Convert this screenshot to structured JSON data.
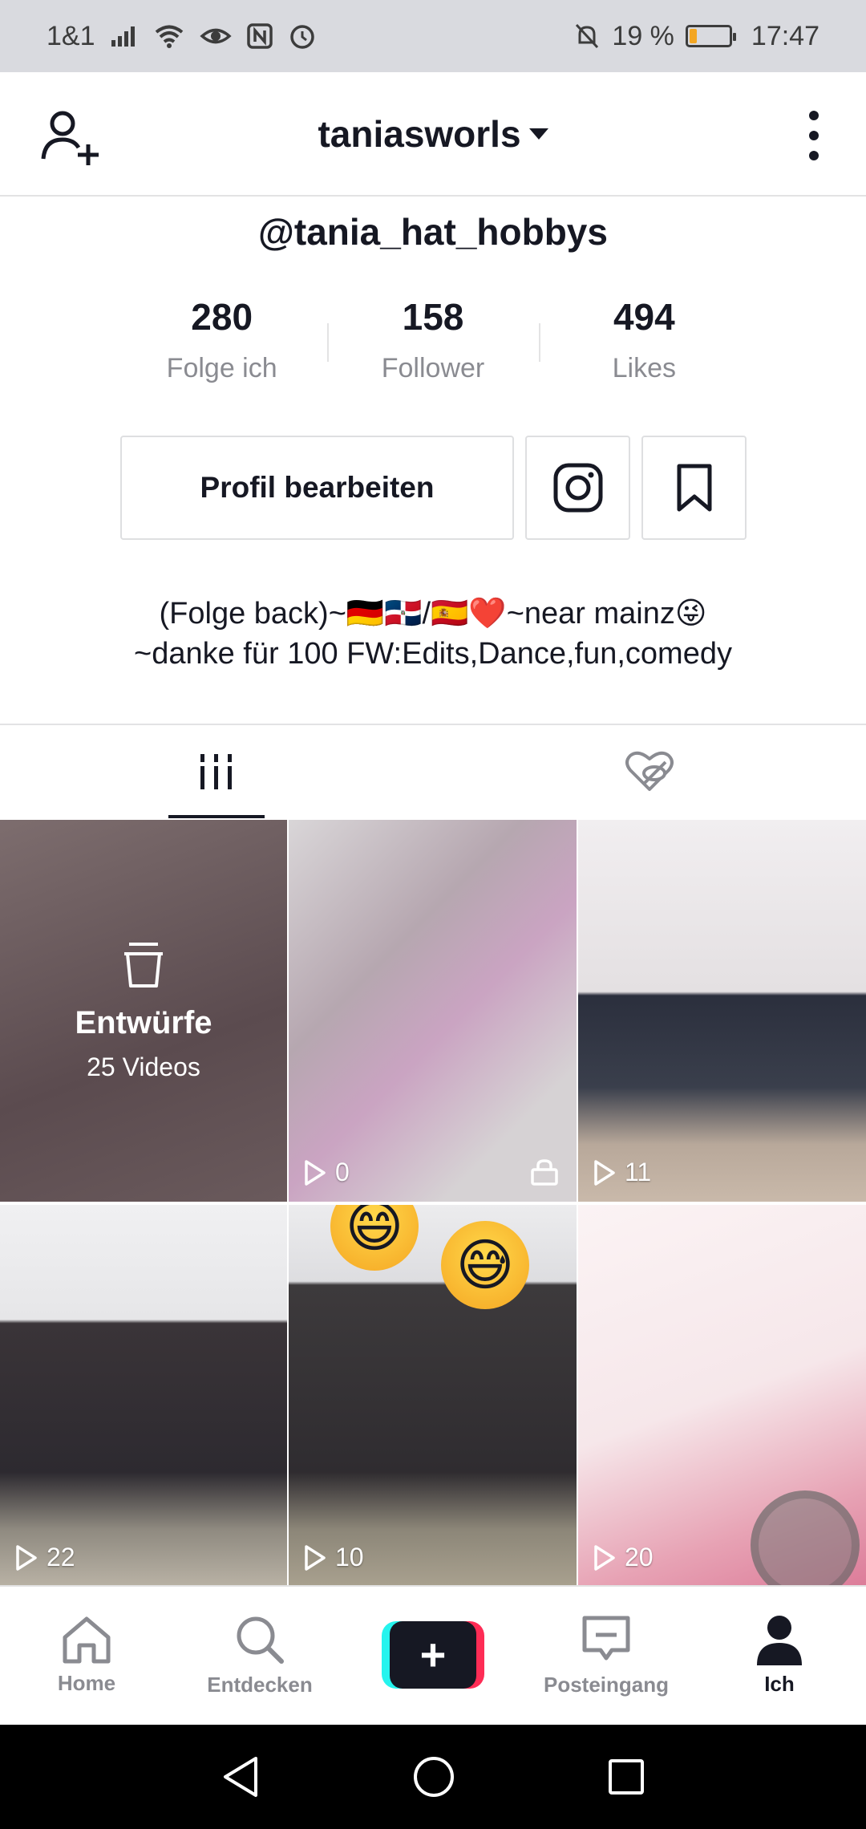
{
  "status_bar": {
    "carrier": "1&1",
    "battery_percent": "19 %",
    "battery_level": 0.19,
    "time": "17:47",
    "icons": [
      "signal-icon",
      "wifi-icon",
      "eye-icon",
      "nfc-icon",
      "alarm-icon",
      "bell-off-icon",
      "battery-icon"
    ]
  },
  "header": {
    "account_name": "taniasworls",
    "icons": [
      "add-user-icon",
      "more-vertical-icon",
      "caret-down-icon"
    ]
  },
  "profile": {
    "handle": "@tania_hat_hobbys",
    "stats": [
      {
        "value": "280",
        "label": "Folge ich"
      },
      {
        "value": "158",
        "label": "Follower"
      },
      {
        "value": "494",
        "label": "Likes"
      }
    ],
    "edit_button": "Profil bearbeiten",
    "bio_line1": "(Folge back)~🇩🇪🇩🇴/🇪🇸❤️~near mainz😜",
    "bio_line2": "~danke für 100 FW:Edits,Dance,fun,comedy"
  },
  "tabs": [
    {
      "name": "videos",
      "icon": "grid-icon",
      "active": true
    },
    {
      "name": "liked",
      "icon": "heart-hidden-icon",
      "active": false
    }
  ],
  "drafts": {
    "title": "Entwürfe",
    "count": "25 Videos"
  },
  "videos": [
    {
      "views": "0",
      "private": true
    },
    {
      "views": "11",
      "private": false
    },
    {
      "views": "22",
      "private": false
    },
    {
      "views": "10",
      "private": false
    },
    {
      "views": "20",
      "private": false
    }
  ],
  "bottom_nav": [
    {
      "label": "Home",
      "icon": "home-icon"
    },
    {
      "label": "Entdecken",
      "icon": "search-icon"
    },
    {
      "label": "",
      "icon": "plus-icon"
    },
    {
      "label": "Posteingang",
      "icon": "inbox-icon"
    },
    {
      "label": "Ich",
      "icon": "profile-icon"
    }
  ],
  "colors": {
    "text": "#161823",
    "secondary_text": "#8a8b91",
    "accent_cyan": "#25f4ee",
    "accent_red": "#fe2c55",
    "status_bar_bg": "#d9dadf"
  }
}
